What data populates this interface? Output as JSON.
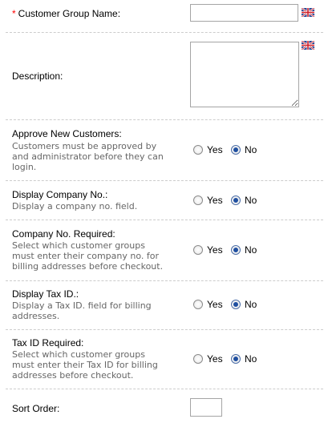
{
  "customer_group_name": {
    "required_mark": "*",
    "label": "Customer Group Name:",
    "value": ""
  },
  "description": {
    "label": "Description:",
    "value": ""
  },
  "language_flag_icon": "uk-flag-icon",
  "radio_labels": {
    "yes": "Yes",
    "no": "No"
  },
  "approve_new_customers": {
    "label": "Approve New Customers:",
    "help": "Customers must be approved by\nand administrator before they can\nlogin.",
    "selected": "No"
  },
  "display_company_no": {
    "label": "Display Company No.:",
    "help": "Display a company no. field.",
    "selected": "No"
  },
  "company_no_required": {
    "label": "Company No. Required:",
    "help": "Select which customer groups\nmust enter their company no. for\nbilling addresses before checkout.",
    "selected": "No"
  },
  "display_tax_id": {
    "label": "Display Tax ID.:",
    "help": "Display a Tax ID. field for billing\naddresses.",
    "selected": "No"
  },
  "tax_id_required": {
    "label": "Tax ID Required:",
    "help": "Select which customer groups\nmust enter their Tax ID for billing\naddresses before checkout.",
    "selected": "No"
  },
  "sort_order": {
    "label": "Sort Order:",
    "value": ""
  }
}
